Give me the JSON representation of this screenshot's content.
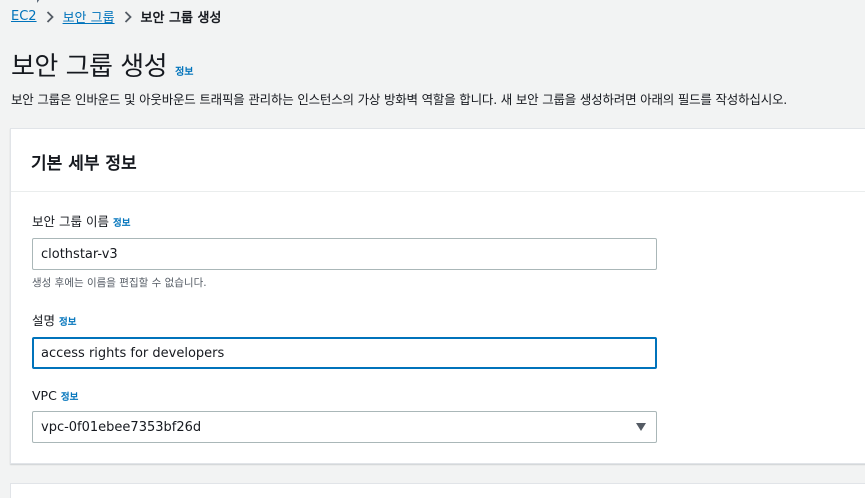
{
  "breadcrumb": {
    "items": [
      "EC2",
      "보안 그룹"
    ],
    "current": "보안 그룹 생성"
  },
  "header": {
    "title": "보안 그룹 생성",
    "info": "정보",
    "description": "보안 그룹은 인바운드 및 아웃바운드 트래픽을 관리하는 인스턴스의 가상 방화벽 역할을 합니다. 새 보안 그룹을 생성하려면 아래의 필드를 작성하십시오."
  },
  "panel": {
    "title": "기본 세부 정보",
    "name_field": {
      "label": "보안 그룹 이름",
      "info": "정보",
      "value": "clothstar-v3",
      "hint": "생성 후에는 이름을 편집할 수 없습니다."
    },
    "description_field": {
      "label": "설명",
      "info": "정보",
      "value": "access rights for developers"
    },
    "vpc_field": {
      "label": "VPC",
      "info": "정보",
      "value": "vpc-0f01ebee7353bf26d"
    }
  },
  "colors": {
    "link": "#0073bb",
    "background": "#f2f3f3",
    "text": "#16191f",
    "border": "#aab7b8"
  }
}
